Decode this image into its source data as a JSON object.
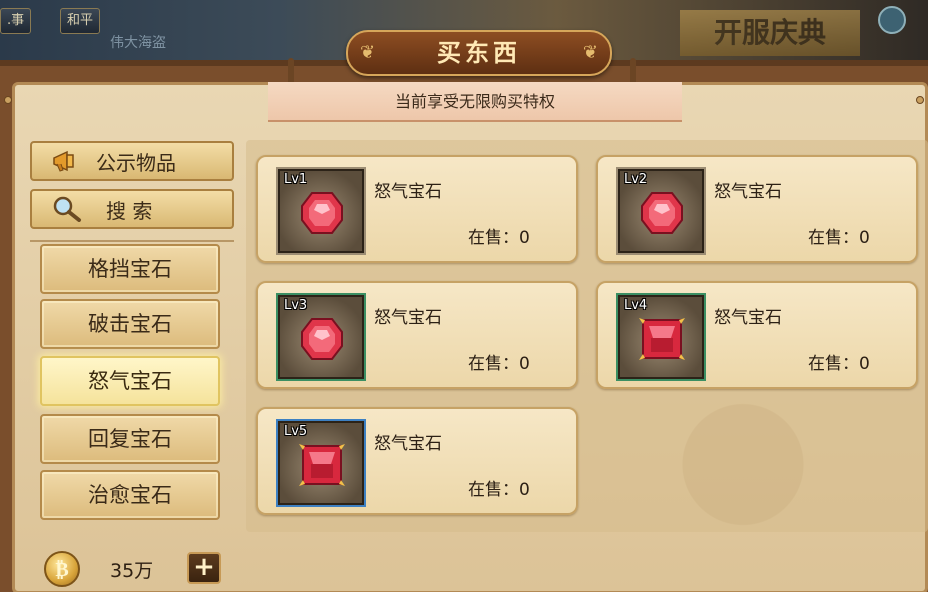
{
  "background": {
    "tabs": [
      ".事",
      "和平"
    ],
    "subtitle": "伟大海盗",
    "event_banner": "开服庆典"
  },
  "window": {
    "title": "买东西",
    "privilege_text": "当前享受无限购买特权"
  },
  "left_panel": {
    "announce_label": "公示物品",
    "search_label": "搜 索",
    "categories": [
      "格挡宝石",
      "破击宝石",
      "怒气宝石",
      "回复宝石",
      "治愈宝石"
    ],
    "active_category": "怒气宝石"
  },
  "currency": {
    "amount": "35万"
  },
  "items": [
    {
      "level": "Lv1",
      "name": "怒气宝石",
      "stock": "在售：0"
    },
    {
      "level": "Lv2",
      "name": "怒气宝石",
      "stock": "在售：0"
    },
    {
      "level": "Lv3",
      "name": "怒气宝石",
      "stock": "在售：0"
    },
    {
      "level": "Lv4",
      "name": "怒气宝石",
      "stock": "在售：0"
    },
    {
      "level": "Lv5",
      "name": "怒气宝石",
      "stock": "在售：0"
    }
  ],
  "colors": {
    "gem_red": "#e0354a",
    "frame_brown": "#7a4e2c",
    "parchment": "#e9d7b3",
    "active_highlight": "#fff6c9"
  }
}
